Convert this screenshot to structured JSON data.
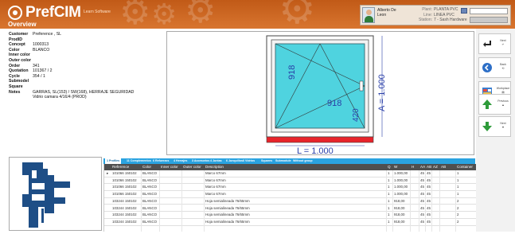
{
  "app": {
    "title": "PrefCIM",
    "subtitle": "Learn Software",
    "page_title": "Overview"
  },
  "user": {
    "name": "Alberto De Leon",
    "plant_label": "Plant:",
    "plant_value": "PLANTA PVC",
    "line_label": "Line:",
    "line_value": "LINEA PVC",
    "station_label": "Station:",
    "station_value": "7 - Sash Hardware"
  },
  "details": [
    {
      "key": "Customer",
      "value": "Preference , SL"
    },
    {
      "key": "ProdID",
      "value": ""
    },
    {
      "key": "Concept",
      "value": "1000313"
    },
    {
      "key": "Color",
      "value": "BLANCO"
    },
    {
      "key": "Inner color",
      "value": ""
    },
    {
      "key": "Outer color",
      "value": ""
    },
    {
      "key": "Order",
      "value": "341"
    },
    {
      "key": "Quotation",
      "value": "101367 / 2"
    },
    {
      "key": "Cycle",
      "value": "354 / 1"
    },
    {
      "key": "Submodel",
      "value": ""
    },
    {
      "key": "Square",
      "value": ""
    },
    {
      "key": "Notes",
      "value": "GARRAS, SL(153) / SW(168), HERRAJE SEGURIDAD"
    },
    {
      "key": "",
      "value": "Vidrio camara 4/16/4 (PROD)"
    }
  ],
  "drawing": {
    "dim_918_left": "918",
    "dim_918_mid": "918",
    "dim_420": "420",
    "label_a": "A = 1.000",
    "label_l": "L = 1.000"
  },
  "sidebar_buttons": [
    {
      "label": "Next\n↵"
    },
    {
      "label": "Back\n⟲"
    },
    {
      "label": "Workplace\n▤"
    },
    {
      "label": "Previous\n▲"
    },
    {
      "label": "Next\n▼"
    }
  ],
  "tabs": [
    "1 Profiles",
    "11 Complementos",
    "6 Refuerzos",
    "4 Herrajes",
    "3 Accesorios",
    "4 Juntas",
    "6 Junquillos",
    "6 Vidrios",
    "Squares",
    "Submodule",
    "Without group"
  ],
  "grid": {
    "columns": [
      "Reference",
      "Color",
      "Inner color",
      "Outer color",
      "Description",
      "Q",
      "W",
      "H",
      "AA",
      "AB",
      "AZ",
      "AB",
      "Container"
    ],
    "rows": [
      [
        "101066 150102",
        "BLANCO",
        "",
        "",
        "Marco 67mm",
        "1",
        "1.000,00",
        "",
        "45",
        "45",
        "",
        "",
        "1"
      ],
      [
        "101066 150102",
        "BLANCO",
        "",
        "",
        "Marco 67mm",
        "1",
        "1.000,00",
        "",
        "45",
        "45",
        "",
        "",
        "1"
      ],
      [
        "101066 150102",
        "BLANCO",
        "",
        "",
        "Marco 67mm",
        "1",
        "1.000,00",
        "",
        "45",
        "45",
        "",
        "",
        "1"
      ],
      [
        "101066 150102",
        "BLANCO",
        "",
        "",
        "Marco 67mm",
        "1",
        "1.000,00",
        "",
        "45",
        "45",
        "",
        "",
        "1"
      ],
      [
        "103244 150102",
        "BLANCO",
        "",
        "",
        "Hoja semialineada 76/65mm",
        "1",
        "918,00",
        "",
        "45",
        "45",
        "",
        "",
        "2"
      ],
      [
        "103244 150102",
        "BLANCO",
        "",
        "",
        "Hoja semialineada 76/65mm",
        "1",
        "918,00",
        "",
        "45",
        "45",
        "",
        "",
        "2"
      ],
      [
        "103244 150102",
        "BLANCO",
        "",
        "",
        "Hoja semialineada 76/65mm",
        "1",
        "918,00",
        "",
        "45",
        "45",
        "",
        "",
        "2"
      ],
      [
        "103244 150102",
        "BLANCO",
        "",
        "",
        "Hoja semialineada 76/65mm",
        "1",
        "918,00",
        "",
        "45",
        "45",
        "",
        "",
        "2"
      ]
    ]
  },
  "colors": {
    "header": "#c85f1c",
    "tab_bar": "#2aa3e0",
    "grid_header": "#4f4f4f",
    "glass": "#4fd3df",
    "sill": "#e8232a"
  }
}
